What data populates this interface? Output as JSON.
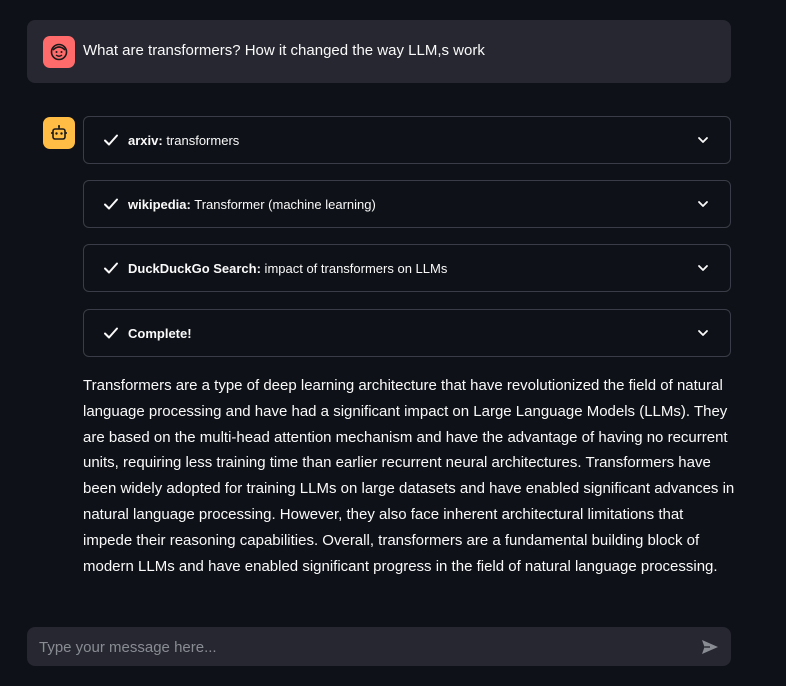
{
  "user_message": {
    "text": "What are transformers? How it changed the way LLM,s work",
    "avatar_icon": "smiley-face-icon",
    "avatar_color": "#ff6b6b"
  },
  "assistant": {
    "avatar_icon": "robot-icon",
    "avatar_color": "#ffbd45",
    "expanders": [
      {
        "tool": "arxiv:",
        "query": " transformers",
        "status_icon": "check-icon"
      },
      {
        "tool": "wikipedia:",
        "query": " Transformer (machine learning)",
        "status_icon": "check-icon"
      },
      {
        "tool": "DuckDuckGo Search:",
        "query": " impact of transformers on LLMs",
        "status_icon": "check-icon"
      },
      {
        "tool": "Complete!",
        "query": "",
        "status_icon": "check-icon"
      }
    ],
    "answer_lines": [
      "Transformers are a type of deep learning architecture that have revolutionized the field of natural",
      "language processing and have had a significant impact on Large Language Models (LLMs). They",
      "are based on the multi-head attention mechanism and have the advantage of having no recurrent",
      "units, requiring less training time than earlier recurrent neural architectures. Transformers have",
      "been widely adopted for training LLMs on large datasets and have enabled significant advances in",
      "natural language processing. However, they also face inherent architectural limitations that",
      "impede their reasoning capabilities. Overall, transformers are a fundamental building block of",
      "modern LLMs and have enabled significant progress in the field of natural language processing."
    ]
  },
  "chat_input": {
    "placeholder": "Type your message here...",
    "value": "",
    "send_icon": "send-icon"
  },
  "colors": {
    "background": "#0e1117",
    "panel": "#262730",
    "border": "#3a3d47",
    "text": "#fafafa"
  }
}
